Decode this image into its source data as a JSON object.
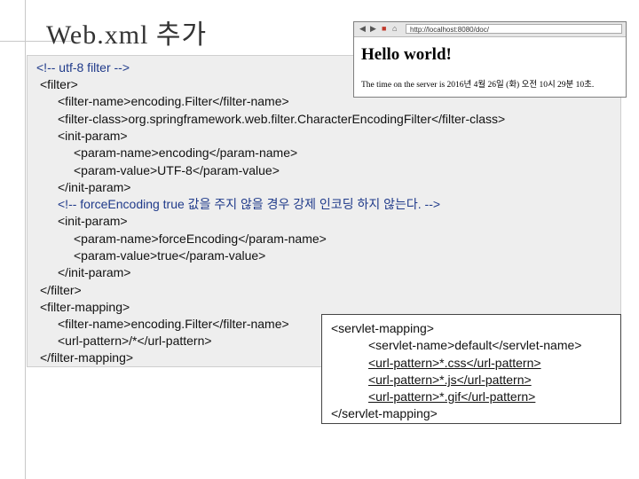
{
  "slide": {
    "title": "Web.xml 추가"
  },
  "code_lines": [
    "<!-- utf-8 filter -->",
    "<filter>",
    "<filter-name>encoding.Filter</filter-name>",
    "<filter-class>org.springframework.web.filter.CharacterEncodingFilter</filter-class>",
    "<init-param>",
    "<param-name>encoding</param-name>",
    "<param-value>UTF-8</param-value>",
    "</init-param>",
    "<!-- forceEncoding true 값을 주지 않을 경우 강제 인코딩 하지 않는다. -->",
    "<init-param>",
    "<param-name>forceEncoding</param-name>",
    "<param-value>true</param-value>",
    "</init-param>",
    "</filter>",
    "<filter-mapping>",
    "<filter-name>encoding.Filter</filter-name>",
    "<url-pattern>/*</url-pattern>",
    "</filter-mapping>"
  ],
  "servlet_lines": [
    "<servlet-mapping>",
    "<servlet-name>default</servlet-name>",
    "<url-pattern>*.css</url-pattern>",
    "<url-pattern>*.js</url-pattern>",
    "<url-pattern>*.gif</url-pattern>",
    "</servlet-mapping>"
  ],
  "browser": {
    "url": "http://localhost:8080/doc/",
    "heading": "Hello world!",
    "time_text": "The time on the server is 2016년 4월 26일 (화) 오전 10시 29분 10초."
  },
  "icons": {
    "back": "back-arrow-icon",
    "forward": "forward-arrow-icon",
    "stop": "stop-icon",
    "home": "home-icon"
  }
}
